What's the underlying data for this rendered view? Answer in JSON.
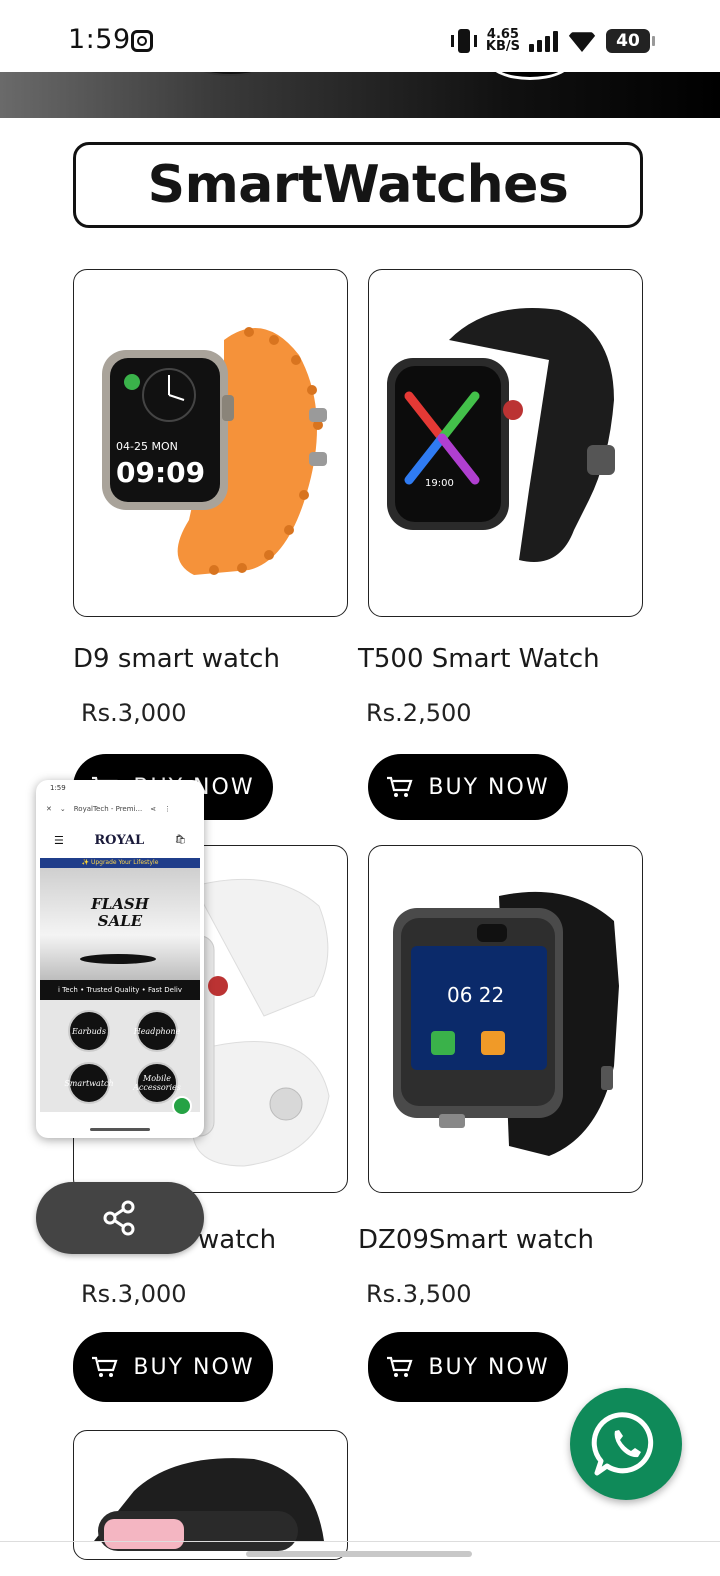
{
  "status_bar": {
    "time": "1:59",
    "net_speed_value": "4.65",
    "net_speed_unit": "KB/S",
    "battery": "40"
  },
  "page": {
    "title": "SmartWatches"
  },
  "products": [
    {
      "name": "D9 smart watch",
      "price": "Rs.3,000",
      "button": "BUY NOW",
      "band_color": "#f5923a"
    },
    {
      "name": "T500 Smart Watch",
      "price": "Rs.2,500",
      "button": "BUY NOW",
      "band_color": "#1c1c1c"
    },
    {
      "name": "watch",
      "price": "Rs.3,000",
      "button": "BUY NOW",
      "band_color": "#f2f2f2"
    },
    {
      "name": "DZ09Smart watch",
      "price": "Rs.3,500",
      "button": "BUY NOW",
      "band_color": "#161616"
    }
  ],
  "colors": {
    "accent": "#000000",
    "whatsapp": "#0f8a59",
    "share_pill": "#444444"
  },
  "preview": {
    "time": "1:59",
    "url_title": "RoyalTech - Premi...",
    "logo": "ROYAL",
    "strip": "✨ Upgrade Your Lifestyle",
    "flash_line1": "FLASH",
    "flash_line2": "SALE",
    "tagline": "i Tech • Trusted Quality • Fast Deliv",
    "categories": [
      "Earbuds",
      "Headphone",
      "Smartwatch",
      "Mobile Accessories"
    ]
  },
  "icons": {
    "cart": "cart-icon",
    "share": "share-icon",
    "whatsapp": "whatsapp-icon"
  }
}
